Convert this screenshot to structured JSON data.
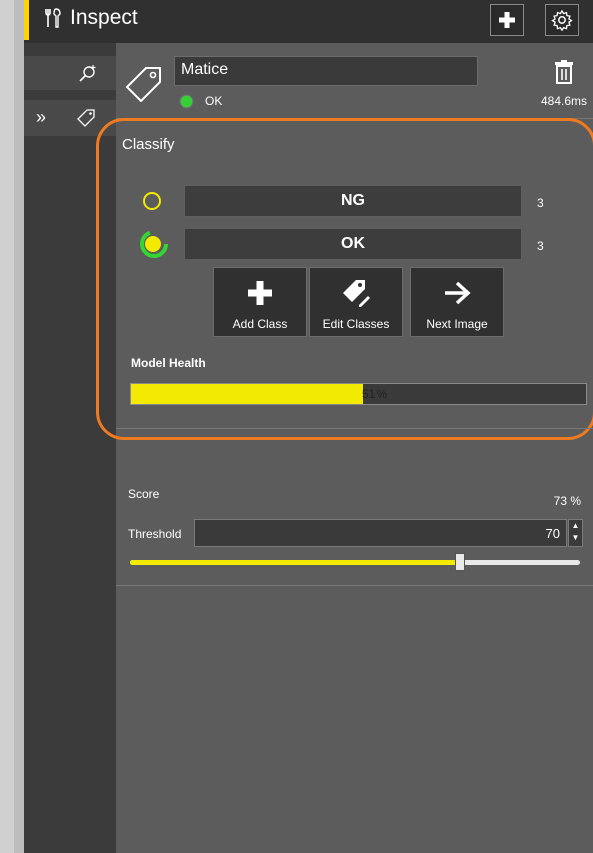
{
  "header": {
    "title": "Inspect",
    "accent": "#ffd500",
    "icons": [
      "tools-icon",
      "plus-icon",
      "gear-icon"
    ]
  },
  "tool": {
    "name": "Matice",
    "status": "OK",
    "status_color": "#35d035",
    "timing": "484.6ms"
  },
  "classify": {
    "title": "Classify",
    "highlight_color": "#f07a1f",
    "classes": [
      {
        "label": "NG",
        "count": "3",
        "selected": false
      },
      {
        "label": "OK",
        "count": "3",
        "selected": true
      }
    ],
    "actions": [
      {
        "label": "Add Class",
        "icon": "plus-icon"
      },
      {
        "label": "Edit Classes",
        "icon": "tag-edit-icon"
      },
      {
        "label": "Next Image",
        "icon": "arrow-right-icon"
      }
    ],
    "model_health": {
      "label": "Model Health",
      "value": "51",
      "unit": "%",
      "fraction": 0.51,
      "color": "#f2ea00"
    }
  },
  "score": {
    "label": "Score",
    "value": "73 %"
  },
  "threshold": {
    "label": "Threshold",
    "value": "70",
    "slider_fraction": 0.7
  }
}
